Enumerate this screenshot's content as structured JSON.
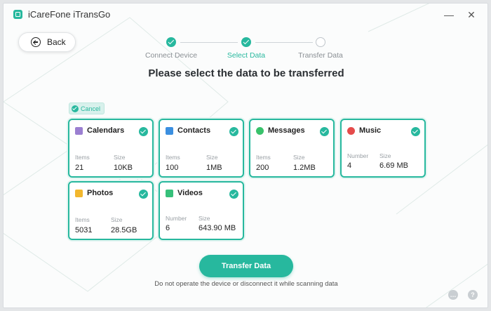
{
  "app": {
    "title": "iCareFone iTransGo"
  },
  "window_controls": {
    "minimize_glyph": "—",
    "close_glyph": "✕"
  },
  "back_button": {
    "label": "Back",
    "icon": "back-arrow-icon"
  },
  "steps": [
    {
      "label": "Connect Device",
      "state": "done"
    },
    {
      "label": "Select Data",
      "state": "done"
    },
    {
      "label": "Transfer Data",
      "state": "pending"
    }
  ],
  "heading": "Please select the data to be transferred",
  "cancel_chip": {
    "label": "Cancel"
  },
  "cards": [
    {
      "title": "Calendars",
      "icon": "calendar-icon",
      "icon_color": "#9b7fd1",
      "stat1_label": "Items",
      "stat1_value": "21",
      "stat2_label": "Size",
      "stat2_value": "10KB",
      "selected": true
    },
    {
      "title": "Contacts",
      "icon": "contacts-icon",
      "icon_color": "#3b8fe0",
      "stat1_label": "Items",
      "stat1_value": "100",
      "stat2_label": "Size",
      "stat2_value": "1MB",
      "selected": true
    },
    {
      "title": "Messages",
      "icon": "messages-icon",
      "icon_color": "#39c26b",
      "stat1_label": "Items",
      "stat1_value": "200",
      "stat2_label": "Size",
      "stat2_value": "1.2MB",
      "selected": true
    },
    {
      "title": "Music",
      "icon": "music-icon",
      "icon_color": "#e54b4b",
      "stat1_label": "Number",
      "stat1_value": "4",
      "stat2_label": "Size",
      "stat2_value": "6.69 MB",
      "selected": true
    },
    {
      "title": "Photos",
      "icon": "photos-icon",
      "icon_color": "#f2b72e",
      "stat1_label": "Items",
      "stat1_value": "5031",
      "stat2_label": "Size",
      "stat2_value": "28.5GB",
      "selected": true
    },
    {
      "title": "Videos",
      "icon": "videos-icon",
      "icon_color": "#36c07a",
      "stat1_label": "Number",
      "stat1_value": "6",
      "stat2_label": "Size",
      "stat2_value": "643.90 MB",
      "selected": true
    }
  ],
  "transfer_button": {
    "label": "Transfer Data"
  },
  "hint": "Do not operate the device or disconnect it while scanning data",
  "footer_icons": [
    {
      "icon": "chat-icon",
      "glyph": "…"
    },
    {
      "icon": "help-icon",
      "glyph": "?"
    }
  ],
  "colors": {
    "accent": "#27b89e"
  }
}
